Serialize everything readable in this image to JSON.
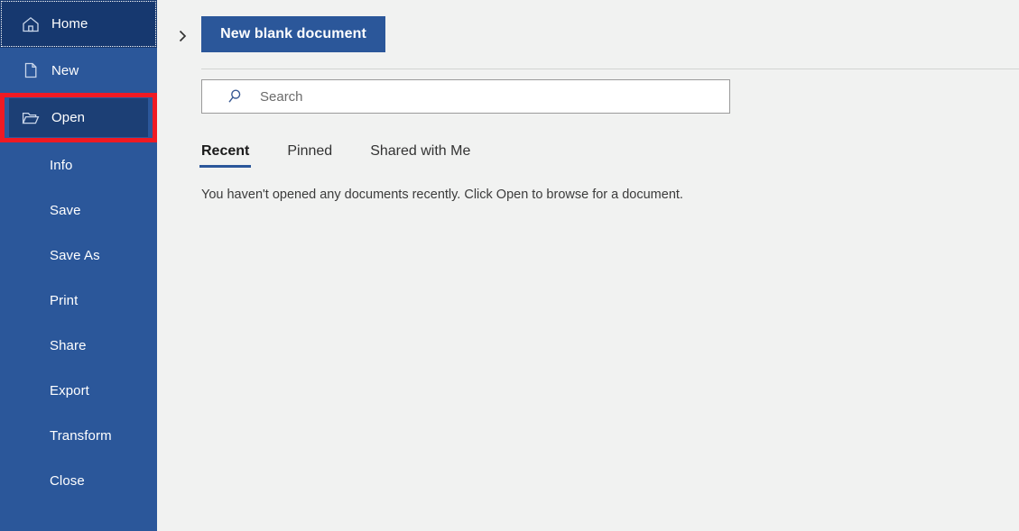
{
  "sidebar": {
    "items": [
      {
        "label": "Home",
        "icon": "home-icon",
        "state": "focused"
      },
      {
        "label": "New",
        "icon": "document-icon",
        "state": "normal"
      },
      {
        "label": "Open",
        "icon": "folder-open-icon",
        "state": "selected"
      },
      {
        "label": "Info",
        "icon": null,
        "state": "normal"
      },
      {
        "label": "Save",
        "icon": null,
        "state": "normal"
      },
      {
        "label": "Save As",
        "icon": null,
        "state": "normal"
      },
      {
        "label": "Print",
        "icon": null,
        "state": "normal"
      },
      {
        "label": "Share",
        "icon": null,
        "state": "normal"
      },
      {
        "label": "Export",
        "icon": null,
        "state": "normal"
      },
      {
        "label": "Transform",
        "icon": null,
        "state": "normal"
      },
      {
        "label": "Close",
        "icon": null,
        "state": "normal"
      }
    ],
    "background_color": "#2b579a",
    "selected_color": "#1c3f75",
    "focused_color": "#16386f"
  },
  "highlight": {
    "target": "Open",
    "color": "#ef1a23"
  },
  "main": {
    "back_chevron": "chevron-right-icon",
    "new_blank_document_label": "New blank document",
    "search": {
      "placeholder": "Search",
      "value": "",
      "icon": "search-icon"
    },
    "tabs": [
      {
        "label": "Recent",
        "active": true
      },
      {
        "label": "Pinned",
        "active": false
      },
      {
        "label": "Shared with Me",
        "active": false
      }
    ],
    "empty_message": "You haven't opened any documents recently. Click Open to browse for a document.",
    "accent_color": "#2b579a",
    "background_color": "#f1f2f1"
  }
}
